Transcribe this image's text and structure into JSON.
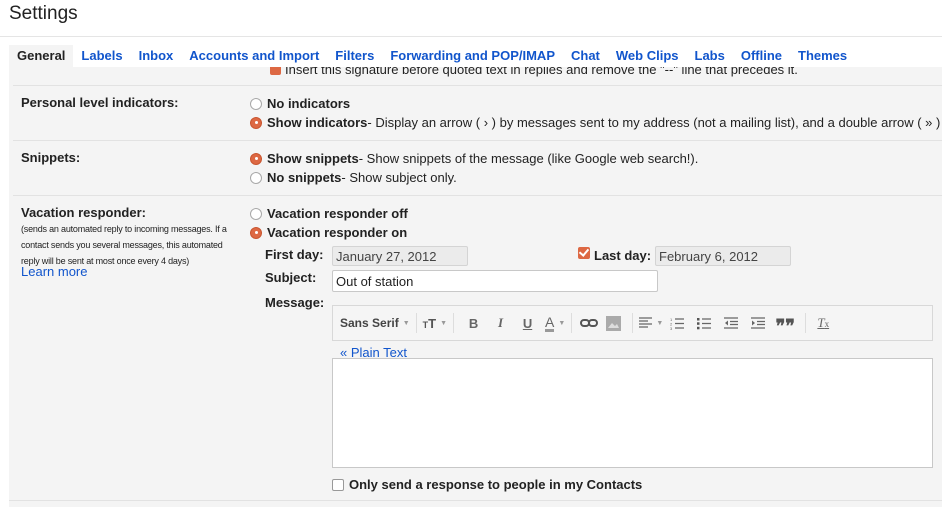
{
  "page_title": "Settings",
  "tabs": [
    {
      "label": "General",
      "active": true
    },
    {
      "label": "Labels"
    },
    {
      "label": "Inbox"
    },
    {
      "label": "Accounts and Import"
    },
    {
      "label": "Filters"
    },
    {
      "label": "Forwarding and POP/IMAP"
    },
    {
      "label": "Chat"
    },
    {
      "label": "Web Clips"
    },
    {
      "label": "Labs"
    },
    {
      "label": "Offline"
    },
    {
      "label": "Themes"
    }
  ],
  "signature_option": "Insert this signature before quoted text in replies and remove the \"--\" line that precedes it.",
  "personal_indicators": {
    "label": "Personal level indicators:",
    "options": [
      {
        "title": "No indicators",
        "desc": "",
        "checked": false
      },
      {
        "title": "Show indicators",
        "desc": " - Display an arrow ( › ) by messages sent to my address (not a mailing list), and a double arrow ( » )",
        "checked": true
      }
    ]
  },
  "snippets": {
    "label": "Snippets:",
    "options": [
      {
        "title": "Show snippets",
        "desc": " - Show snippets of the message (like Google web search!).",
        "checked": true
      },
      {
        "title": "No snippets",
        "desc": " - Show subject only.",
        "checked": false
      }
    ]
  },
  "vacation": {
    "label": "Vacation responder:",
    "description": "(sends an automated reply to incoming messages. If a contact sends you several messages, this automated reply will be sent at most once every 4 days)",
    "learn_more": "Learn more",
    "options": [
      {
        "title": "Vacation responder off",
        "checked": false
      },
      {
        "title": "Vacation responder on",
        "checked": true
      }
    ],
    "first_day_label": "First day:",
    "first_day_value": "January 27, 2012",
    "last_day_label": "Last day:",
    "last_day_checked": true,
    "last_day_value": "February 6, 2012",
    "subject_label": "Subject:",
    "subject_value": "Out of station",
    "message_label": "Message:",
    "toolbar": {
      "font": "Sans Serif",
      "icons": [
        "font-size-icon",
        "bold-icon",
        "italic-icon",
        "underline-icon",
        "text-color-icon",
        "link-icon",
        "image-icon",
        "align-icon",
        "numbered-list-icon",
        "bulleted-list-icon",
        "indent-less-icon",
        "indent-more-icon",
        "quote-icon",
        "remove-formatting-icon"
      ]
    },
    "plain_text_link": "« Plain Text",
    "message_value": "",
    "contacts_only_label": "Only send a response to people in my Contacts",
    "contacts_only_checked": false
  },
  "colors": {
    "link": "#1155cc",
    "accent": "#dd6843",
    "panel_bg": "#f4f4f4"
  }
}
